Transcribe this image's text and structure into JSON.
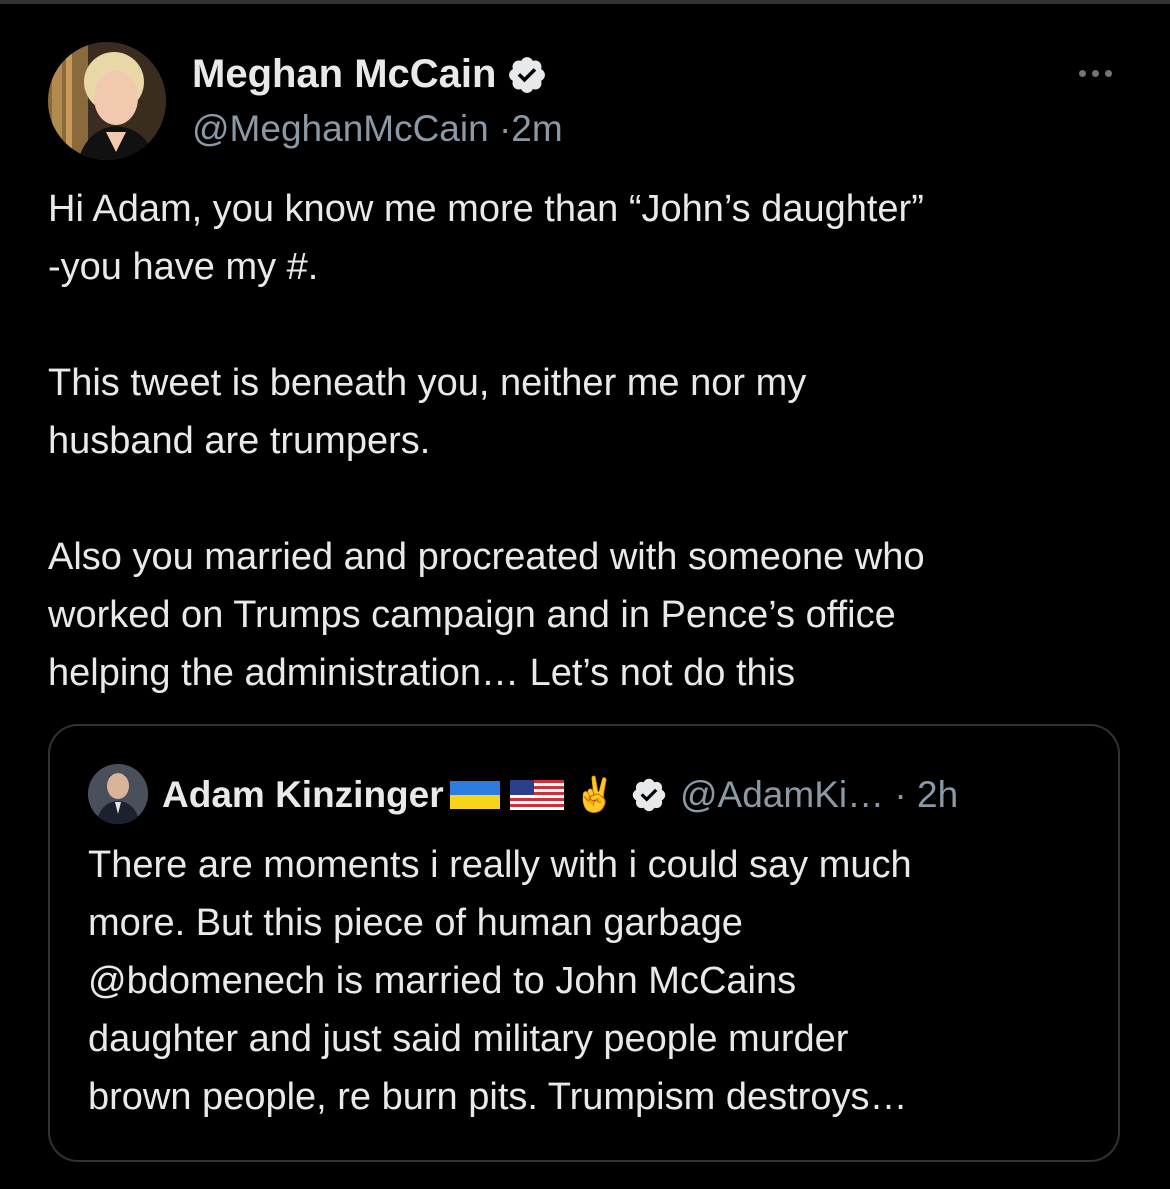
{
  "tweet": {
    "author": {
      "display_name": "Meghan McCain",
      "handle": "@MeghanMcCain",
      "separator": "·",
      "time": "2m",
      "verified": true,
      "avatar_icon": "profile-photo"
    },
    "paragraphs": [
      [
        "Hi Adam, you know me more than “John’s daughter”",
        "-you have my #."
      ],
      [
        "This tweet is beneath you, neither me nor my",
        "husband are trumpers."
      ],
      [
        "Also you married and procreated with someone who",
        "worked on Trumps campaign and in Pence’s office",
        "helping the administration… Let’s not do this"
      ]
    ]
  },
  "quoted_tweet": {
    "author": {
      "display_name": "Adam Kinzinger",
      "name_emojis": [
        "ukraine-flag-icon",
        "us-flag-icon",
        "✌️"
      ],
      "handle": "@AdamKi…",
      "separator": "·",
      "time": "2h",
      "verified": true
    },
    "lines": [
      "There are moments i really with i could say much",
      "more.  But this piece of human garbage",
      "@bdomenech is married to John McCains",
      "daughter and just said military people murder",
      "brown people, re burn pits.  Trumpism destroys…"
    ]
  },
  "colors": {
    "background": "#000000",
    "text_primary": "#e7e9ea",
    "text_secondary": "#8b98a5",
    "border": "#2f3336"
  }
}
